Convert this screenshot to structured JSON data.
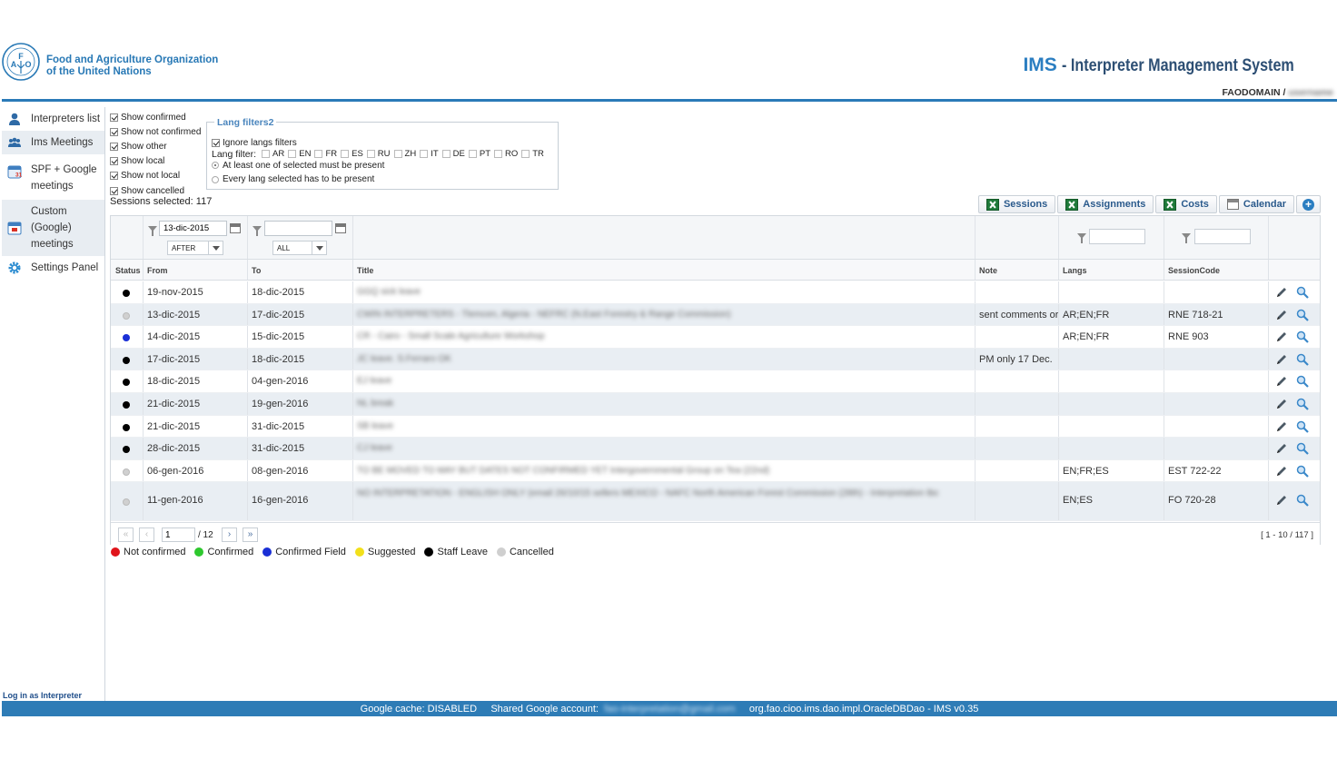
{
  "header": {
    "org_line1": "Food and Agriculture Organization",
    "org_line2": "of the United Nations",
    "app_short": "IMS",
    "app_long": "- Interpreter Management System",
    "user_domain": "FAODOMAIN /",
    "user_name": "username"
  },
  "sidebar": {
    "items": [
      {
        "label": "Interpreters list"
      },
      {
        "label": "Ims Meetings"
      },
      {
        "label": "SPF + Google meetings"
      },
      {
        "label": "Custom (Google) meetings"
      },
      {
        "label": "Settings Panel"
      }
    ],
    "login_link": "Log in as Interpreter"
  },
  "filters": {
    "checkboxes": [
      {
        "label": "Show confirmed",
        "checked": true
      },
      {
        "label": "Show not confirmed",
        "checked": true
      },
      {
        "label": "Show other",
        "checked": true
      },
      {
        "label": "Show local",
        "checked": true
      },
      {
        "label": "Show not local",
        "checked": true
      },
      {
        "label": "Show cancelled",
        "checked": true
      }
    ],
    "sessions_selected": "Sessions selected: 117",
    "lang_box": {
      "legend": "Lang filters2",
      "ignore_label": "Ignore langs filters",
      "lang_filter_label": "Lang filter:",
      "langs": [
        "AR",
        "EN",
        "FR",
        "ES",
        "RU",
        "ZH",
        "IT",
        "DE",
        "PT",
        "RO",
        "TR"
      ],
      "radio_any": "At least one of selected must be present",
      "radio_every": "Every lang selected has to be present"
    }
  },
  "toolbar": {
    "sessions": "Sessions",
    "assignments": "Assignments",
    "costs": "Costs",
    "calendar": "Calendar"
  },
  "grid": {
    "from_filter_value": "13-dic-2015",
    "from_filter_mode": "AFTER",
    "to_filter_value": "",
    "to_filter_mode": "ALL",
    "headers": {
      "status": "Status",
      "from": "From",
      "to": "To",
      "title": "Title",
      "note": "Note",
      "langs": "Langs",
      "session_code": "SessionCode"
    },
    "rows": [
      {
        "status_color": "#000000",
        "from": "19-nov-2015",
        "to": "18-dic-2015",
        "title": "GGQ sick leave",
        "note": "",
        "langs": "",
        "code": ""
      },
      {
        "status_color": "#d0d0d0",
        "from": "13-dic-2015",
        "to": "17-dic-2015",
        "title": "CWIN INTERPRETERS - Tlemcen, Algeria - NEFRC (N.East Forestry & Range Commission)",
        "note": "sent comments or",
        "langs": "AR;EN;FR",
        "code": "RNE 718-21"
      },
      {
        "status_color": "#1a2fd6",
        "from": "14-dic-2015",
        "to": "15-dic-2015",
        "title": "CR - Cairo - Small Scale Agriculture Workshop",
        "note": "",
        "langs": "AR;EN;FR",
        "code": "RNE 903"
      },
      {
        "status_color": "#000000",
        "from": "17-dic-2015",
        "to": "18-dic-2015",
        "title": "JC leave. S.Ferraro OK",
        "note": "PM only 17 Dec.",
        "langs": "",
        "code": ""
      },
      {
        "status_color": "#000000",
        "from": "18-dic-2015",
        "to": "04-gen-2016",
        "title": "EJ leave",
        "note": "",
        "langs": "",
        "code": ""
      },
      {
        "status_color": "#000000",
        "from": "21-dic-2015",
        "to": "19-gen-2016",
        "title": "NL break",
        "note": "",
        "langs": "",
        "code": ""
      },
      {
        "status_color": "#000000",
        "from": "21-dic-2015",
        "to": "31-dic-2015",
        "title": "SB leave",
        "note": "",
        "langs": "",
        "code": ""
      },
      {
        "status_color": "#000000",
        "from": "28-dic-2015",
        "to": "31-dic-2015",
        "title": "CJ leave",
        "note": "",
        "langs": "",
        "code": ""
      },
      {
        "status_color": "#d0d0d0",
        "from": "06-gen-2016",
        "to": "08-gen-2016",
        "title": "TO BE MOVED TO MAY BUT DATES NOT CONFIRMED YET Intergovernmental Group on Tea (22nd)",
        "note": "",
        "langs": "EN;FR;ES",
        "code": "EST 722-22"
      },
      {
        "status_color": "#d0d0d0",
        "from": "11-gen-2016",
        "to": "16-gen-2016",
        "title": "NO INTERPRETATION - ENGLISH ONLY (email 26/10/15 sellers MEXICO - NAFC North American Forest Commission (28th) - Interpretation tbc",
        "note": "",
        "langs": "EN;ES",
        "code": "FO 720-28"
      }
    ],
    "pager": {
      "page": "1",
      "total": "/ 12",
      "info": "[ 1 - 10 / 117 ]"
    }
  },
  "legend": [
    {
      "label": "Not confirmed",
      "color": "#e0141b"
    },
    {
      "label": "Confirmed",
      "color": "#2ec82e"
    },
    {
      "label": "Confirmed Field",
      "color": "#1a2fd6"
    },
    {
      "label": "Suggested",
      "color": "#f2e01a"
    },
    {
      "label": "Staff Leave",
      "color": "#000000"
    },
    {
      "label": "Cancelled",
      "color": "#cfcfcf"
    }
  ],
  "footer": {
    "cache": "Google cache:  DISABLED",
    "shared_label": "Shared Google account:",
    "shared_value": "fao-interpretation@gmail.com",
    "dao": "org.fao.cioo.ims.dao.impl.OracleDBDao  -  IMS v0.35"
  }
}
